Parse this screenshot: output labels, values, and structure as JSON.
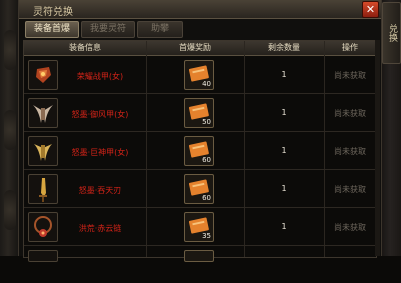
{
  "window": {
    "title": "灵符兑换",
    "close_icon": "close-icon",
    "side_tab": "兑换"
  },
  "tabs": [
    {
      "label": "装备首爆",
      "active": true
    },
    {
      "label": "我要灵符",
      "active": false
    },
    {
      "label": "助攀",
      "active": false
    }
  ],
  "table": {
    "headers": [
      "装备信息",
      "首爆奖励",
      "剩余数量",
      "操作"
    ],
    "rows": [
      {
        "item": "荣耀战甲(女)",
        "icon": "armor-icon",
        "reward_count": "40",
        "remaining": "1",
        "status": "尚未获取"
      },
      {
        "item": "怒墨·御风甲(女)",
        "icon": "wings-armor-icon",
        "reward_count": "50",
        "remaining": "1",
        "status": "尚未获取"
      },
      {
        "item": "怒墨·巨神甲(女)",
        "icon": "golden-armor-icon",
        "reward_count": "60",
        "remaining": "1",
        "status": "尚未获取"
      },
      {
        "item": "怒墨·吞天刃",
        "icon": "blade-icon",
        "reward_count": "60",
        "remaining": "1",
        "status": "尚未获取"
      },
      {
        "item": "洪荒·赤云链",
        "icon": "necklace-icon",
        "reward_count": "35",
        "remaining": "1",
        "status": "尚未获取"
      }
    ]
  },
  "colors": {
    "item_name": "#d42318",
    "status": "#6e675d",
    "header_text": "#e6dcc2"
  }
}
